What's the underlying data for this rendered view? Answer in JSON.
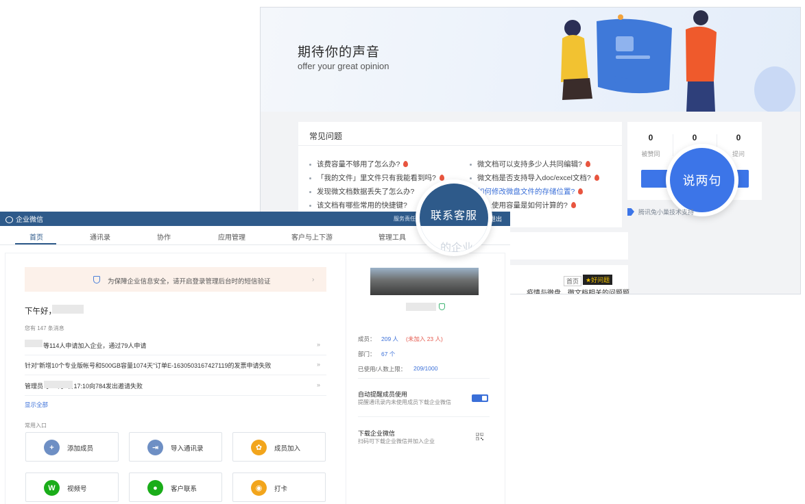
{
  "feedback": {
    "hero_title": "期待你的声音",
    "hero_subtitle": "offer your great opinion",
    "faq_title": "常见问题",
    "faq_left": [
      "该费容量不够用了怎么办?",
      "「我的文件」里文件只有我能看到吗?",
      "发现微文档数据丢失了怎么办?",
      "该文档有哪些常用的快捷键?"
    ],
    "faq_right": [
      "微文档可以支持多少人共同编辑?",
      "微文档是否支持导入doc/excel文档?",
      "如何修改微盘文件的存储位置?",
      "个人使用容量是如何计算的?"
    ],
    "stats": [
      {
        "value": "0",
        "label": "被赞同"
      },
      {
        "value": "0",
        "label": ""
      },
      {
        "value": "0",
        "label": "提问"
      }
    ],
    "say_button": "说两句",
    "support_text": "腾讯兔小巢技术支持",
    "news_tag_home": "首页",
    "news_tag_good": "好问题",
    "news_text": "疫情与微盘、微文档相关的问题题"
  },
  "wecom": {
    "brand": "企业微信",
    "service_link": "服务责任书",
    "exit_link": "退出",
    "customer_service": "联系客服",
    "cs_faint": "的企业",
    "tabs": [
      "首页",
      "通讯录",
      "协作",
      "应用管理",
      "客户与上下游",
      "管理工具"
    ],
    "alert": "为保障企业信息安全，请开启登录管理后台时的短信验证",
    "greeting": "下午好，",
    "message_count": "您有 147 条消息",
    "messages": [
      "等114人申请加入企业，通过79人申请",
      "针对“新增10个专业版帐号和500GB容量1074天”订单E-1630503167427119的发票申请失败",
      "管理员          于12月2日17:10向784发出邀请失败"
    ],
    "show_all": "显示全部",
    "entries_title": "常用入口",
    "entries": [
      {
        "label": "添加成员",
        "icon": "add-user-icon",
        "color": "#6e8fc4"
      },
      {
        "label": "导入通讯录",
        "icon": "import-icon",
        "color": "#6e8fc4"
      },
      {
        "label": "成员加入",
        "icon": "members-icon",
        "color": "#f2a51c"
      },
      {
        "label": "视频号",
        "icon": "channels-icon",
        "color": "#1aad19"
      },
      {
        "label": "客户联系",
        "icon": "wechat-icon",
        "color": "#1aad19"
      },
      {
        "label": "打卡",
        "icon": "location-icon",
        "color": "#f2a51c"
      }
    ],
    "members_label": "成员：",
    "members_value": "209 人",
    "members_unjoined": "(未加入 23 人)",
    "depts_label": "部门：",
    "depts_value": "67 个",
    "used_label": "已使用/人数上限：",
    "used_value": "209/1000",
    "remind_title": "自动提醒成员使用",
    "remind_sub": "提醒通讯录内未使用成员下载企业微信",
    "download_title": "下载企业微信",
    "download_sub": "扫码可下载企业微信并加入企业"
  },
  "colors": {
    "wecom_blue": "#2e5a8a",
    "link_blue": "#3a6fd8",
    "feedback_blue": "#3c75e8",
    "warn_red": "#e55a4e"
  }
}
